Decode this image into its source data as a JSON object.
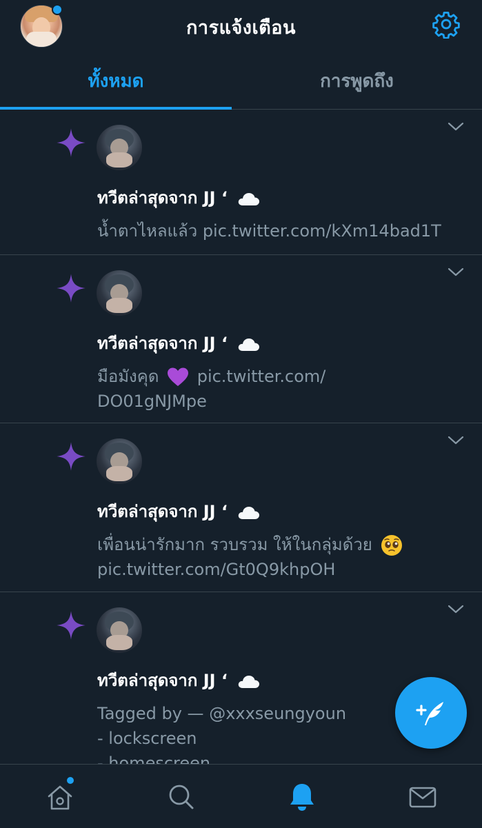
{
  "header": {
    "title": "การแจ้งเตือน",
    "avatar_has_notification": true,
    "settings_icon": "gear-icon"
  },
  "tabs": [
    {
      "label": "ทั้งหมด",
      "active": true
    },
    {
      "label": "การพูดถึง",
      "active": false
    }
  ],
  "notifications": [
    {
      "icon": "sparkle-icon",
      "title": "ทวีตล่าสุดจาก JJ ‘",
      "title_emoji": "cloud",
      "body_lines": [
        "น้ำตาไหลแล้ว pic.twitter.com/kXm14bad1T"
      ]
    },
    {
      "icon": "sparkle-icon",
      "title": "ทวีตล่าสุดจาก JJ ‘",
      "title_emoji": "cloud",
      "body_line1_prefix": "มือมังคุด",
      "body_line1_emoji": "purple-heart",
      "body_line1_suffix": "pic.twitter.com/",
      "body_line2": "DO01gNJMpe"
    },
    {
      "icon": "sparkle-icon",
      "title": "ทวีตล่าสุดจาก JJ ‘",
      "title_emoji": "cloud",
      "body_line1_prefix": "เพื่อนน่ารักมาก รวบรวม ให้ในกลุ่มด้วย",
      "body_line1_emoji": "pleading-face",
      "body_line2": "pic.twitter.com/Gt0Q9khpOH"
    },
    {
      "icon": "sparkle-icon",
      "title": "ทวีตล่าสุดจาก JJ ‘",
      "title_emoji": "cloud",
      "body_lines": [
        "Tagged by — @xxxseungyoun",
        "- lockscreen",
        "- homescreen"
      ]
    }
  ],
  "bottom_nav": [
    {
      "icon": "home-icon",
      "active": false,
      "has_dot": true
    },
    {
      "icon": "search-icon",
      "active": false
    },
    {
      "icon": "bell-icon",
      "active": true
    },
    {
      "icon": "mail-icon",
      "active": false
    }
  ],
  "compose_icon": "compose-tweet-icon",
  "colors": {
    "background": "#15202b",
    "accent": "#1da1f2",
    "sparkle": "#794bc4",
    "secondary_text": "#8899a6",
    "divider": "#38444d"
  }
}
